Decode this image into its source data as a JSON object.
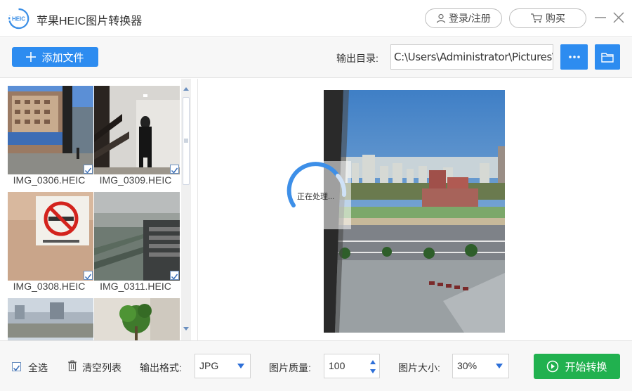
{
  "app": {
    "title": "苹果HEIC图片转换器",
    "logo_text": "HEIC",
    "login_label": "登录/注册",
    "buy_label": "购买"
  },
  "toolbar": {
    "add_label": "添加文件",
    "output_dir_label": "输出目录:",
    "output_dir_value": "C:\\Users\\Administrator\\Pictures\\",
    "more_label": "···"
  },
  "files": [
    {
      "name": "IMG_0306.HEIC",
      "checked": true
    },
    {
      "name": "IMG_0309.HEIC",
      "checked": true
    },
    {
      "name": "IMG_0308.HEIC",
      "checked": true
    },
    {
      "name": "IMG_0311.HEIC",
      "checked": true
    },
    {
      "name": "",
      "checked": false
    },
    {
      "name": "",
      "checked": false
    }
  ],
  "preview": {
    "status_text": "正在处理..."
  },
  "bottom": {
    "select_all_label": "全选",
    "clear_label": "清空列表",
    "format_label": "输出格式:",
    "format_value": "JPG",
    "quality_label": "图片质量:",
    "quality_value": "100",
    "size_label": "图片大小:",
    "size_value": "30%",
    "start_label": "开始转换"
  },
  "colors": {
    "accent_blue": "#2d8cf0",
    "start_green": "#21b14f"
  }
}
